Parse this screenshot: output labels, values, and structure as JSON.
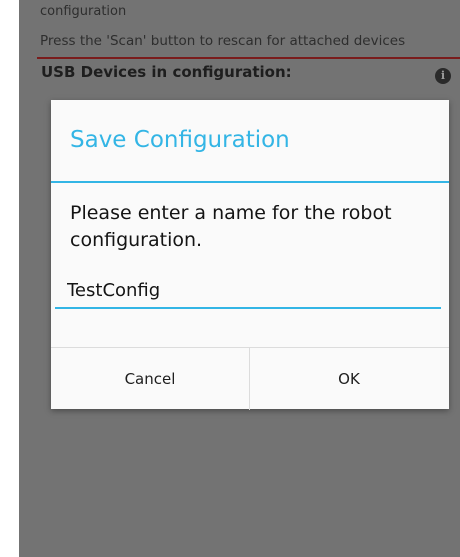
{
  "background": {
    "line1": "configuration",
    "line2": "Press the 'Scan' button to rescan for attached devices",
    "usb_heading": "USB Devices in configuration:",
    "info_icon_glyph": "i"
  },
  "dialog": {
    "title": "Save Configuration",
    "message": "Please enter a name for the robot configuration.",
    "input_value": "TestConfig",
    "cancel_label": "Cancel",
    "ok_label": "OK"
  },
  "colors": {
    "accent": "#33b5e5",
    "scrim": "#737373",
    "divider_red": "#7a1c1c"
  }
}
